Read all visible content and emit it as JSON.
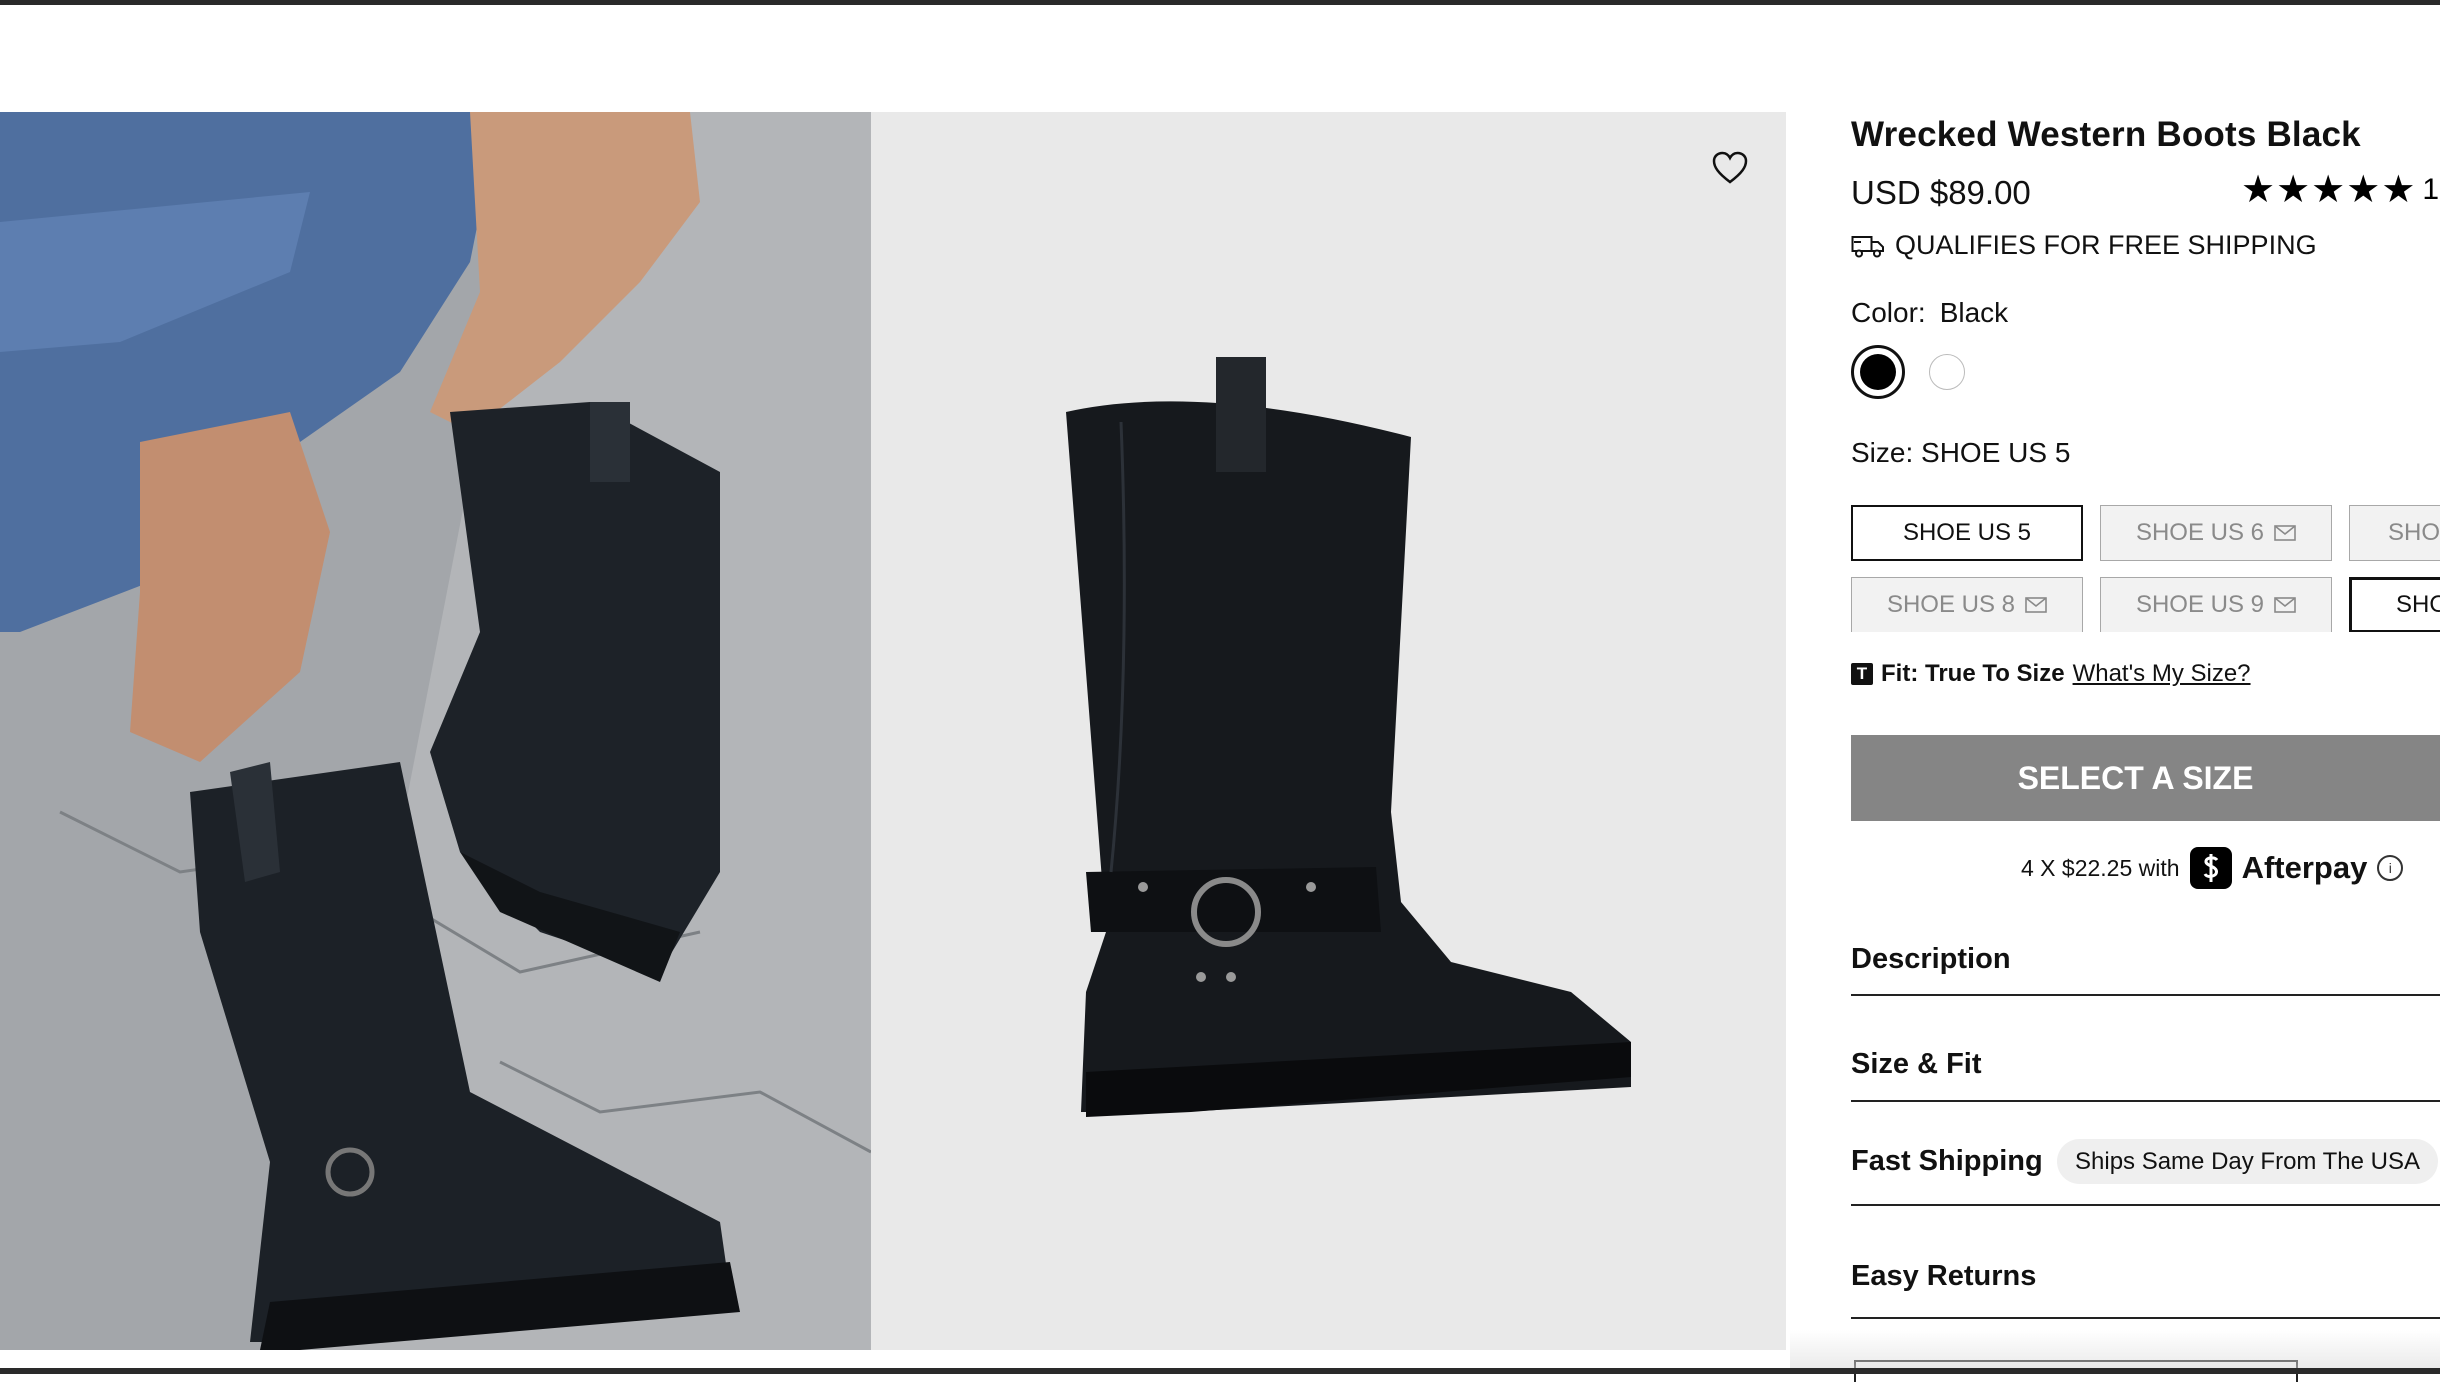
{
  "product": {
    "title": "Wrecked Western Boots Black",
    "price": "USD  $89.00",
    "rating_stars": 5,
    "rating_overflow": "1",
    "shipping_note": "QUALIFIES FOR FREE SHIPPING"
  },
  "color": {
    "label": "Color:",
    "value": "Black",
    "options": [
      "black",
      "white"
    ],
    "selected": "black"
  },
  "size": {
    "label": "Size: SHOE US 5",
    "options": [
      {
        "label": "SHOE US 5",
        "state": "selected"
      },
      {
        "label": "SHOE US 6",
        "state": "notify"
      },
      {
        "label": "SHO",
        "state": "notify"
      },
      {
        "label": "SHOE US 8",
        "state": "notify"
      },
      {
        "label": "SHOE US 9",
        "state": "notify"
      },
      {
        "label": "SHO",
        "state": "available"
      }
    ]
  },
  "fit": {
    "badge": "T",
    "text": "Fit: True To Size",
    "link": "What's My Size?"
  },
  "cta": {
    "label": "SELECT A SIZE"
  },
  "afterpay": {
    "text": "4 X $22.25 with",
    "brand": "Afterpay",
    "info": "i"
  },
  "accordion": {
    "description": "Description",
    "size_fit": "Size & Fit",
    "fast_shipping": "Fast Shipping",
    "fast_shipping_pill": "Ships Same Day From The USA",
    "easy_returns": "Easy Returns"
  },
  "icons": {
    "wishlist": "heart-icon",
    "shipping": "truck-icon",
    "notify": "envelope-icon",
    "afterpay": "afterpay-logo",
    "info": "info-icon"
  }
}
